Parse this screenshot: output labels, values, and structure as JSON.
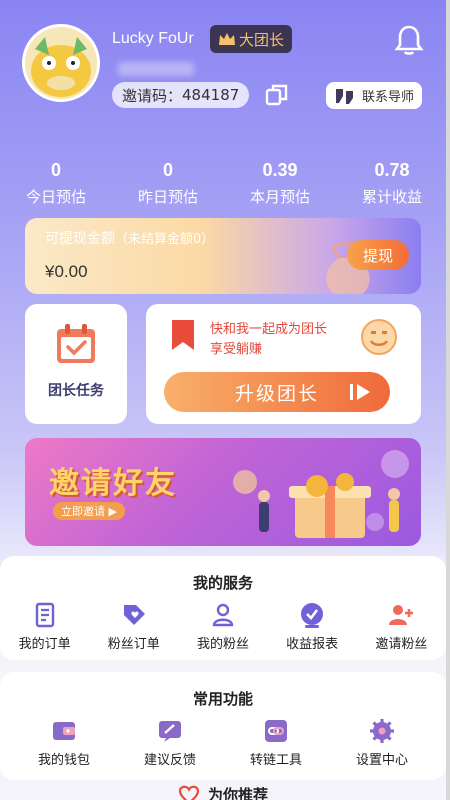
{
  "profile": {
    "username": "Lucky FoUr",
    "rank": "大团长",
    "invite_label": "邀请码：",
    "invite_code": "484187",
    "mentor_button": "联系导师"
  },
  "stats": [
    {
      "value": "0",
      "label": "今日预估"
    },
    {
      "value": "0",
      "label": "昨日预估"
    },
    {
      "value": "0.39",
      "label": "本月预估"
    },
    {
      "value": "0.78",
      "label": "累计收益"
    }
  ],
  "withdraw": {
    "title": "可提现金额",
    "subtitle": "（未结算金额0）",
    "amount": "¥0.00",
    "button": "提现"
  },
  "task": {
    "label": "团长任务"
  },
  "upgrade": {
    "line1": "快和我一起成为团长",
    "line2": "享受躺赚",
    "button": "升级团长"
  },
  "banner": {
    "title": "邀请好友",
    "cta": "立即邀请 ▶"
  },
  "services": {
    "title": "我的服务",
    "items": [
      {
        "label": "我的订单",
        "icon": "order-icon"
      },
      {
        "label": "粉丝订单",
        "icon": "fan-order-icon"
      },
      {
        "label": "我的粉丝",
        "icon": "fans-icon"
      },
      {
        "label": "收益报表",
        "icon": "report-icon"
      },
      {
        "label": "邀请粉丝",
        "icon": "invite-fans-icon"
      }
    ]
  },
  "common": {
    "title": "常用功能",
    "items": [
      {
        "label": "我的钱包",
        "icon": "wallet-icon"
      },
      {
        "label": "建议反馈",
        "icon": "feedback-icon"
      },
      {
        "label": "转链工具",
        "icon": "link-tool-icon"
      },
      {
        "label": "设置中心",
        "icon": "settings-icon"
      }
    ]
  },
  "recommend": {
    "title": "为你推荐"
  },
  "colors": {
    "accent": "#f36c3a",
    "purple": "#8a84f2",
    "icon_purple": "#6f62d8"
  }
}
